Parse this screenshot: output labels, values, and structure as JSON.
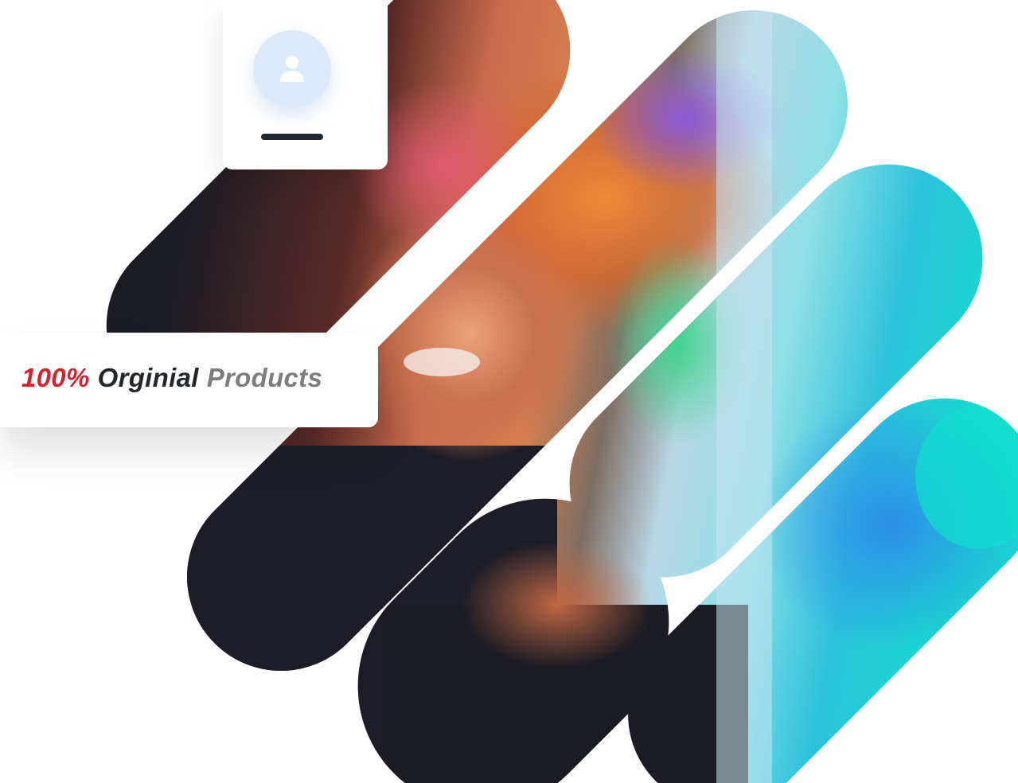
{
  "badge": {
    "percent": "100%",
    "original": "Orginial",
    "products": "Products"
  },
  "colors": {
    "accent_red": "#d2232f",
    "text_dark": "#23262b",
    "text_gray": "#7d7d7d",
    "avatar_bg": "#dbeafb"
  },
  "icons": [
    "user-icon"
  ]
}
